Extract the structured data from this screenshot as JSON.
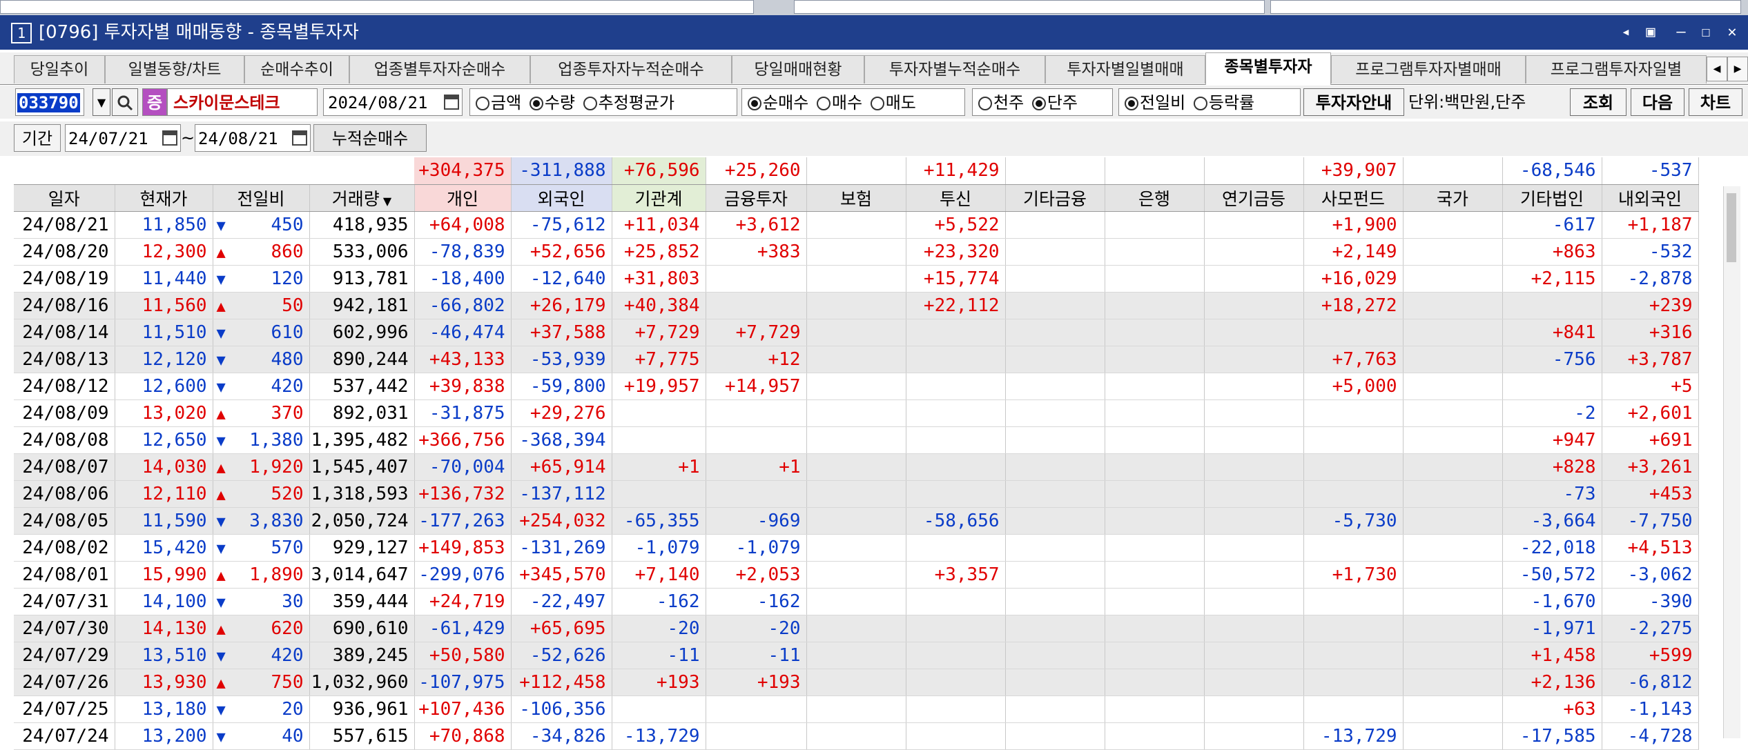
{
  "window": {
    "number": "1",
    "title": "[0796] 투자자별 매매동향 - 종목별투자자"
  },
  "tabs": [
    "당일추이",
    "일별동향/차트",
    "순매수추이",
    "업종별투자자순매수",
    "업종투자자누적순매수",
    "당일매매현황",
    "투자자별누적순매수",
    "투자자별일별매매",
    "종목별투자자",
    "프로그램투자자별매매",
    "프로그램투자자일별"
  ],
  "active_tab": 8,
  "toolbar": {
    "code": "033790",
    "badge": "증",
    "stock_name": "스카이문스테크",
    "date": "2024/08/21",
    "opt1": [
      "금액",
      "수량",
      "추정평균가"
    ],
    "opt1_selected": 1,
    "opt2": [
      "순매수",
      "매수",
      "매도"
    ],
    "opt2_selected": 0,
    "opt3": [
      "천주",
      "단주"
    ],
    "opt3_selected": 1,
    "opt4": [
      "전일비",
      "등락률"
    ],
    "opt4_selected": 0,
    "guide_button": "투자자안내",
    "unit_text": "단위:백만원,단주",
    "search_button": "조회",
    "next_button": "다음",
    "chart_button": "차트"
  },
  "period": {
    "label": "기간",
    "from": "24/07/21",
    "sep": "~",
    "to": "24/08/21",
    "cum_label": "누적순매수",
    "cum_values": [
      "+304,375",
      "-311,888",
      "+76,596",
      "+25,260",
      "",
      "+11,429",
      "",
      "",
      "",
      "+39,907",
      "",
      "-68,546",
      "-537"
    ]
  },
  "columns": [
    "일자",
    "현재가",
    "전일비",
    "거래량",
    "개인",
    "외국인",
    "기관계",
    "금융투자",
    "보험",
    "투신",
    "기타금융",
    "은행",
    "연기금등",
    "사모펀드",
    "국가",
    "기타법인",
    "내외국인"
  ],
  "rows": [
    [
      "24/08/21",
      "11,850",
      "▼",
      "450",
      "418,935",
      "+64,008",
      "-75,612",
      "+11,034",
      "+3,612",
      "",
      "+5,522",
      "",
      "",
      "",
      "+1,900",
      "",
      "-617",
      "+1,187"
    ],
    [
      "24/08/20",
      "12,300",
      "▲",
      "860",
      "533,006",
      "-78,839",
      "+52,656",
      "+25,852",
      "+383",
      "",
      "+23,320",
      "",
      "",
      "",
      "+2,149",
      "",
      "+863",
      "-532"
    ],
    [
      "24/08/19",
      "11,440",
      "▼",
      "120",
      "913,781",
      "-18,400",
      "-12,640",
      "+31,803",
      "",
      "",
      "+15,774",
      "",
      "",
      "",
      "+16,029",
      "",
      "+2,115",
      "-2,878"
    ],
    [
      "24/08/16",
      "11,560",
      "▲",
      "50",
      "942,181",
      "-66,802",
      "+26,179",
      "+40,384",
      "",
      "",
      "+22,112",
      "",
      "",
      "",
      "+18,272",
      "",
      "",
      "+239"
    ],
    [
      "24/08/14",
      "11,510",
      "▼",
      "610",
      "602,996",
      "-46,474",
      "+37,588",
      "+7,729",
      "+7,729",
      "",
      "",
      "",
      "",
      "",
      "",
      "",
      "+841",
      "+316"
    ],
    [
      "24/08/13",
      "12,120",
      "▼",
      "480",
      "890,244",
      "+43,133",
      "-53,939",
      "+7,775",
      "+12",
      "",
      "",
      "",
      "",
      "",
      "+7,763",
      "",
      "-756",
      "+3,787"
    ],
    [
      "24/08/12",
      "12,600",
      "▼",
      "420",
      "537,442",
      "+39,838",
      "-59,800",
      "+19,957",
      "+14,957",
      "",
      "",
      "",
      "",
      "",
      "+5,000",
      "",
      "",
      "+5"
    ],
    [
      "24/08/09",
      "13,020",
      "▲",
      "370",
      "892,031",
      "-31,875",
      "+29,276",
      "",
      "",
      "",
      "",
      "",
      "",
      "",
      "",
      "",
      "-2",
      "+2,601"
    ],
    [
      "24/08/08",
      "12,650",
      "▼",
      "1,380",
      "1,395,482",
      "+366,756",
      "-368,394",
      "",
      "",
      "",
      "",
      "",
      "",
      "",
      "",
      "",
      "+947",
      "+691"
    ],
    [
      "24/08/07",
      "14,030",
      "▲",
      "1,920",
      "1,545,407",
      "-70,004",
      "+65,914",
      "+1",
      "+1",
      "",
      "",
      "",
      "",
      "",
      "",
      "",
      "+828",
      "+3,261"
    ],
    [
      "24/08/06",
      "12,110",
      "▲",
      "520",
      "1,318,593",
      "+136,732",
      "-137,112",
      "",
      "",
      "",
      "",
      "",
      "",
      "",
      "",
      "",
      "-73",
      "+453"
    ],
    [
      "24/08/05",
      "11,590",
      "▼",
      "3,830",
      "2,050,724",
      "-177,263",
      "+254,032",
      "-65,355",
      "-969",
      "",
      "-58,656",
      "",
      "",
      "",
      "-5,730",
      "",
      "-3,664",
      "-7,750"
    ],
    [
      "24/08/02",
      "15,420",
      "▼",
      "570",
      "929,127",
      "+149,853",
      "-131,269",
      "-1,079",
      "-1,079",
      "",
      "",
      "",
      "",
      "",
      "",
      "",
      "-22,018",
      "+4,513"
    ],
    [
      "24/08/01",
      "15,990",
      "▲",
      "1,890",
      "3,014,647",
      "-299,076",
      "+345,570",
      "+7,140",
      "+2,053",
      "",
      "+3,357",
      "",
      "",
      "",
      "+1,730",
      "",
      "-50,572",
      "-3,062"
    ],
    [
      "24/07/31",
      "14,100",
      "▼",
      "30",
      "359,444",
      "+24,719",
      "-22,497",
      "-162",
      "-162",
      "",
      "",
      "",
      "",
      "",
      "",
      "",
      "-1,670",
      "-390"
    ],
    [
      "24/07/30",
      "14,130",
      "▲",
      "620",
      "690,610",
      "-61,429",
      "+65,695",
      "-20",
      "-20",
      "",
      "",
      "",
      "",
      "",
      "",
      "",
      "-1,971",
      "-2,275"
    ],
    [
      "24/07/29",
      "13,510",
      "▼",
      "420",
      "389,245",
      "+50,580",
      "-52,626",
      "-11",
      "-11",
      "",
      "",
      "",
      "",
      "",
      "",
      "",
      "+1,458",
      "+599"
    ],
    [
      "24/07/26",
      "13,930",
      "▲",
      "750",
      "1,032,960",
      "-107,975",
      "+112,458",
      "+193",
      "+193",
      "",
      "",
      "",
      "",
      "",
      "",
      "",
      "+2,136",
      "-6,812"
    ],
    [
      "24/07/25",
      "13,180",
      "▼",
      "20",
      "936,961",
      "+107,436",
      "-106,356",
      "",
      "",
      "",
      "",
      "",
      "",
      "",
      "",
      "",
      "+63",
      "-1,143"
    ],
    [
      "24/07/24",
      "13,200",
      "▼",
      "40",
      "557,615",
      "+70,868",
      "-34,826",
      "-13,729",
      "",
      "",
      "",
      "",
      "",
      "",
      "-13,729",
      "",
      "-17,585",
      "-4,728"
    ]
  ],
  "colors": {
    "title_bg": "#1f3f8c",
    "up": "#e00000",
    "down": "#0a3cc8",
    "cum_individual_bg": "#f9d8d8",
    "cum_foreign_bg": "#d9def2",
    "cum_inst_bg": "#e2eed6"
  }
}
